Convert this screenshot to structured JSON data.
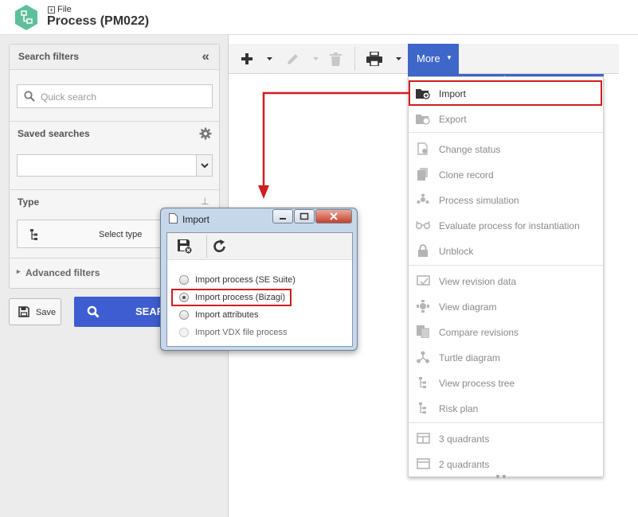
{
  "header": {
    "file_label": "File",
    "title": "Process (PM022)"
  },
  "filters": {
    "title": "Search filters",
    "quick_search_placeholder": "Quick search",
    "saved_searches_label": "Saved searches",
    "saved_searches_value": "",
    "type_label": "Type",
    "select_type_label": "Select type",
    "advanced_label": "Advanced filters",
    "save_label": "Save",
    "search_label": "SEARCH"
  },
  "toolbar": {
    "more_label": "More"
  },
  "menu": {
    "items": [
      {
        "label": "Import",
        "icon": "folder-import-icon",
        "enabled": true
      },
      {
        "label": "Export",
        "icon": "folder-export-icon",
        "enabled": false
      },
      {
        "label": "Change status",
        "icon": "change-status-icon",
        "enabled": false
      },
      {
        "label": "Clone record",
        "icon": "clone-icon",
        "enabled": false
      },
      {
        "label": "Process simulation",
        "icon": "simulation-icon",
        "enabled": false
      },
      {
        "label": "Evaluate process for instantiation",
        "icon": "glasses-icon",
        "enabled": false
      },
      {
        "label": "Unblock",
        "icon": "lock-icon",
        "enabled": false
      },
      {
        "label": "View revision data",
        "icon": "revision-icon",
        "enabled": false
      },
      {
        "label": "View diagram",
        "icon": "diagram-icon",
        "enabled": false
      },
      {
        "label": "Compare revisions",
        "icon": "compare-icon",
        "enabled": false
      },
      {
        "label": "Turtle diagram",
        "icon": "turtle-icon",
        "enabled": false
      },
      {
        "label": "View process tree",
        "icon": "tree-icon",
        "enabled": false
      },
      {
        "label": "Risk plan",
        "icon": "risk-plan-icon",
        "enabled": false
      },
      {
        "label": "3 quadrants",
        "icon": "three-quadrants-icon",
        "enabled": false
      },
      {
        "label": "2 quadrants",
        "icon": "two-quadrants-icon",
        "enabled": false
      }
    ]
  },
  "dialog": {
    "title": "Import",
    "options": [
      {
        "label": "Import process (SE Suite)",
        "selected": false,
        "enabled": true
      },
      {
        "label": "Import process (Bizagi)",
        "selected": true,
        "enabled": true
      },
      {
        "label": "Import attributes",
        "selected": false,
        "enabled": true
      },
      {
        "label": "Import VDX file process",
        "selected": false,
        "enabled": false
      }
    ]
  },
  "colors": {
    "accent": "#3f67c9",
    "search_button": "#3d5dd0",
    "highlight": "#cf1e1e",
    "logo": "#5fbf9a"
  }
}
